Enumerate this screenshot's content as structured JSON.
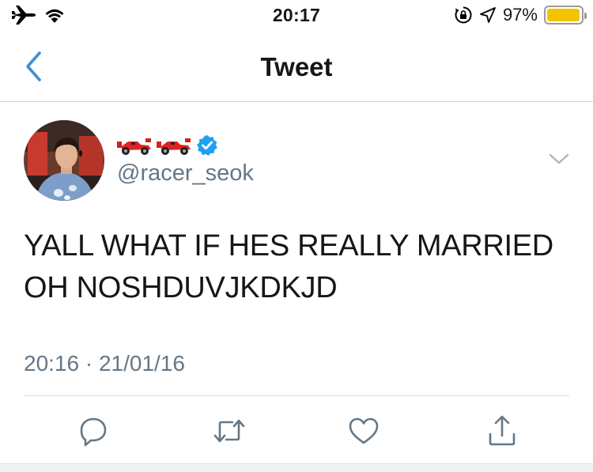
{
  "status_bar": {
    "time": "20:17",
    "battery_percent_text": "97%",
    "battery_level": 0.97,
    "battery_color": "#f5c400",
    "icons": [
      "airplane-icon",
      "wifi-icon",
      "orientation-lock-icon",
      "location-icon",
      "battery-icon"
    ]
  },
  "nav": {
    "title": "Tweet",
    "back_icon": "chevron-left-icon",
    "accent_color": "#3f8fd2"
  },
  "tweet": {
    "display_name_icons": [
      "race-car-emoji",
      "race-car-emoji"
    ],
    "verified": true,
    "verified_color": "#1da1f2",
    "handle": "@racer_seok",
    "text_line_1": "YALL WHAT IF HES REALLY MARRIED",
    "text_line_2": "OH NOSHDUVJKDKJD",
    "timestamp": "20:16 · 21/01/16",
    "menu_icon": "chevron-down-icon"
  },
  "actions": [
    {
      "name": "reply",
      "icon": "reply-icon"
    },
    {
      "name": "retweet",
      "icon": "retweet-icon"
    },
    {
      "name": "like",
      "icon": "heart-icon"
    },
    {
      "name": "share",
      "icon": "share-icon"
    }
  ]
}
